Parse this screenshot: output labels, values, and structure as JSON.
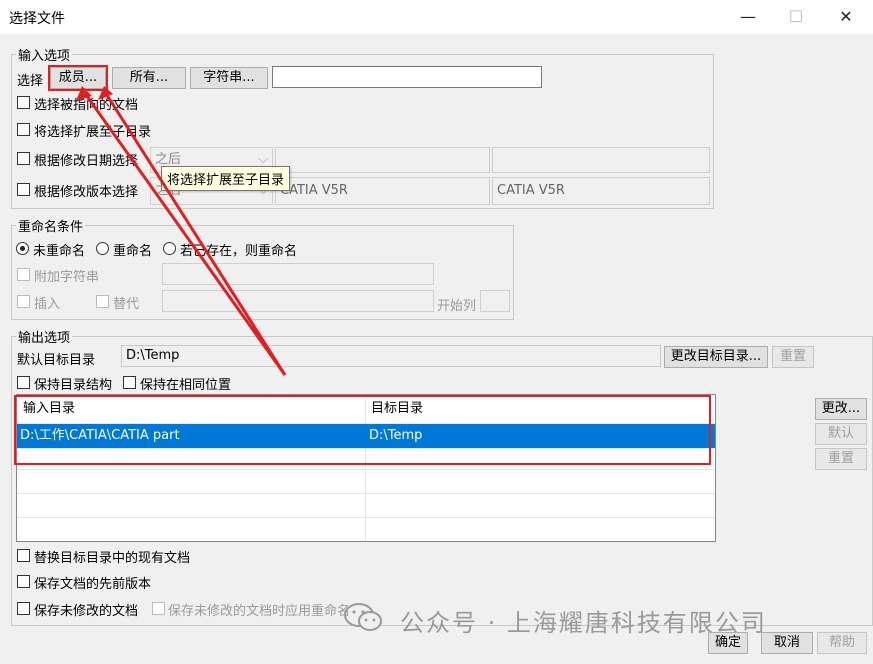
{
  "window": {
    "title": "选择文件",
    "minimize": "—",
    "maximize": "☐",
    "close": "✕"
  },
  "input_options": {
    "legend": "输入选项",
    "select_label": "选择",
    "member_button": "成员...",
    "all_button": "所有...",
    "string_button": "字符串...",
    "select_input_value": "",
    "check_linked": "选择被指向的文档",
    "check_subdir": "将选择扩展至子目录",
    "check_date": "根据修改日期选择",
    "date_mode": "之后",
    "check_version": "根据修改版本选择",
    "version_mode": "之后",
    "version_value_1": "CATIA V5R",
    "version_value_2": "CATIA V5R",
    "tooltip": "将选择扩展至子目录"
  },
  "rename": {
    "legend": "重命名条件",
    "radio_none": "未重命名",
    "radio_rename": "重命名",
    "radio_if_exists": "若已存在，则重命名",
    "check_append": "附加字符串",
    "check_insert": "插入",
    "check_replace": "替代",
    "start_col_label": "开始列"
  },
  "output": {
    "legend": "输出选项",
    "default_dir_label": "默认目标目录",
    "default_dir_value": "D:\\Temp",
    "change_dir_button": "更改目标目录...",
    "reset_button": "重置",
    "keep_structure": "保持目录结构",
    "keep_position": "保持在相同位置",
    "table": {
      "headers": [
        "输入目录",
        "目标目录"
      ],
      "rows": [
        [
          "D:\\工作\\CATIA\\CATIA part",
          "D:\\Temp"
        ]
      ]
    },
    "side_change": "更改...",
    "side_default": "默认",
    "side_reset": "重置",
    "replace_existing": "替换目标目录中的现有文档",
    "save_previous": "保存文档的先前版本",
    "save_unmodified": "保存未修改的文档",
    "apply_rename_unmodified": "保存未修改的文档时应用重命名"
  },
  "footer": {
    "ok": "确定",
    "cancel": "取消",
    "help": "帮助"
  },
  "watermark": "公众号 · 上海耀唐科技有限公司",
  "colors": {
    "selection": "#0078d7",
    "annotation": "#e02020"
  }
}
